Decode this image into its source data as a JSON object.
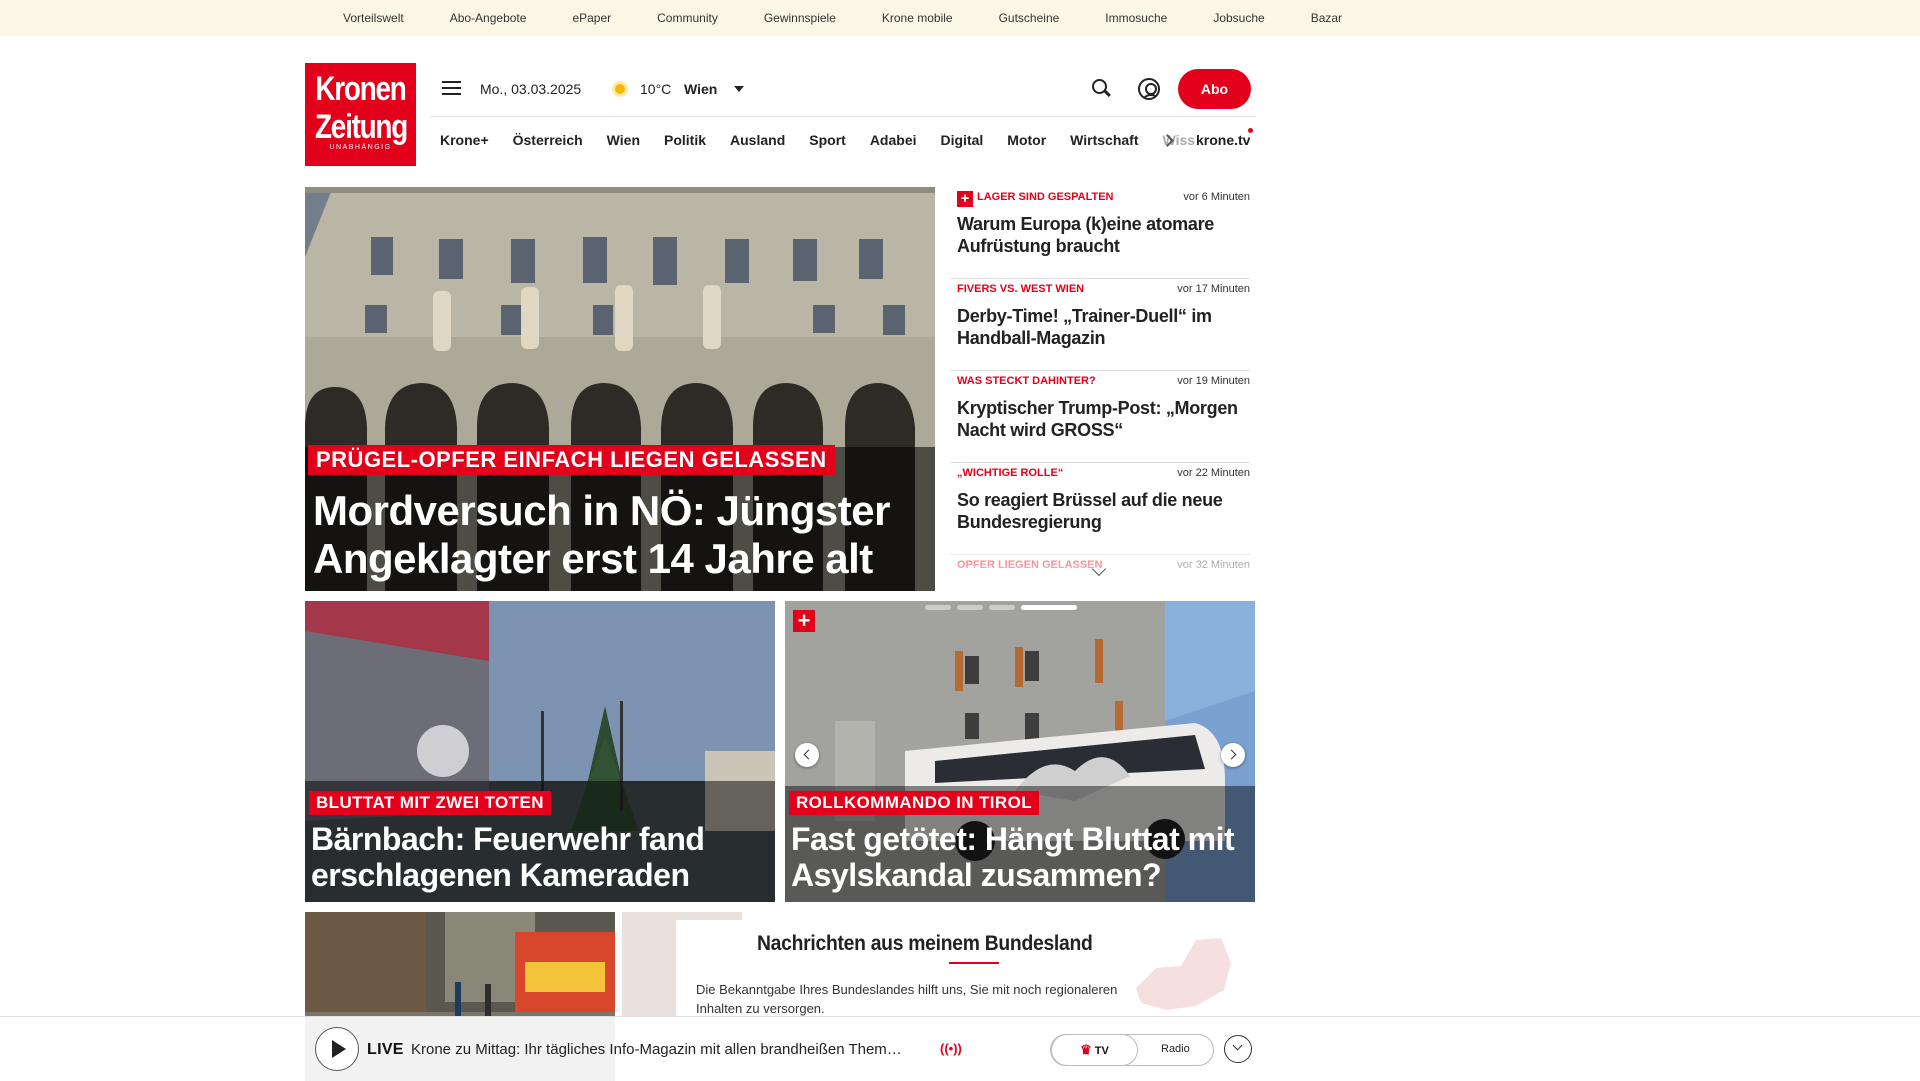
{
  "topnav": [
    "Vorteilswelt",
    "Abo-Angebote",
    "ePaper",
    "Community",
    "Gewinnspiele",
    "Krone mobile",
    "Gutscheine",
    "Immosuche",
    "Jobsuche",
    "Bazar"
  ],
  "logo": {
    "line1": "Kronen",
    "line2": "Zeitung",
    "line3": "UNABHÄNGIG"
  },
  "header": {
    "date": "Mo., 03.03.2025",
    "temperature": "10°C",
    "city": "Wien",
    "abo_label": "Abo"
  },
  "nav": {
    "items": [
      "Krone+",
      "Österreich",
      "Wien",
      "Politik",
      "Ausland",
      "Sport",
      "Adabei",
      "Digital",
      "Motor",
      "Wirtschaft"
    ],
    "overflow": "Wiss",
    "tv": "krone.tv"
  },
  "hero": {
    "kicker": "PRÜGEL-OPFER EINFACH LIEGEN GELASSEN",
    "headline": "Mordversuch in NÖ: Jüngster Angeklagter erst 14 Jahre alt"
  },
  "sidebar": [
    {
      "kicker": "LAGER SIND GESPALTEN",
      "time": "vor 6 Minuten",
      "title": "Warum Europa (k)eine atomare Aufrüstung braucht",
      "plus": true
    },
    {
      "kicker": "FIVERS VS. WEST WIEN",
      "time": "vor 17 Minuten",
      "title": "Derby-Time! „Trainer-Duell“ im Handball-Magazin",
      "plus": false
    },
    {
      "kicker": "WAS STECKT DAHINTER?",
      "time": "vor 19 Minuten",
      "title": "Kryptischer Trump-Post: „Morgen Nacht wird GROSS“",
      "plus": false
    },
    {
      "kicker": "„WICHTIGE ROLLE“",
      "time": "vor 22 Minuten",
      "title": "So reagiert Brüssel auf die neue Bundesregierung",
      "plus": false
    },
    {
      "kicker": "OPFER LIEGEN GELASSEN",
      "time": "vor 32 Minuten",
      "title": "",
      "plus": false
    }
  ],
  "cards": [
    {
      "kicker": "BLUTTAT MIT ZWEI TOTEN",
      "headline": "Bärnbach: Feuerwehr fand erschlagenen Kameraden"
    },
    {
      "kicker": "ROLLKOMMANDO IN TIROL",
      "headline": "Fast getötet: Hängt Bluttat mit Asylskandal zusammen?"
    }
  ],
  "modal": {
    "title": "Nachrichten aus meinem Bundesland",
    "text": "Die Bekanntgabe Ihres Bundeslandes hilft uns, Sie mit noch regionaleren Inhalten zu versorgen."
  },
  "player": {
    "live": "LIVE",
    "title": "Krone zu Mittag: Ihr tägliches Info-Magazin mit allen brandheißen Them…",
    "tv": "TV",
    "radio": "Radio"
  },
  "colors": {
    "brand_red": "#e2001a",
    "topbar_bg": "#fbf7e6"
  },
  "icons": [
    "menu-icon",
    "weather-sun-icon",
    "search-icon",
    "user-icon",
    "chevron-right-icon",
    "chevron-down-icon",
    "play-icon",
    "radio-broadcast-icon",
    "crown-icon",
    "plus-badge-icon"
  ]
}
